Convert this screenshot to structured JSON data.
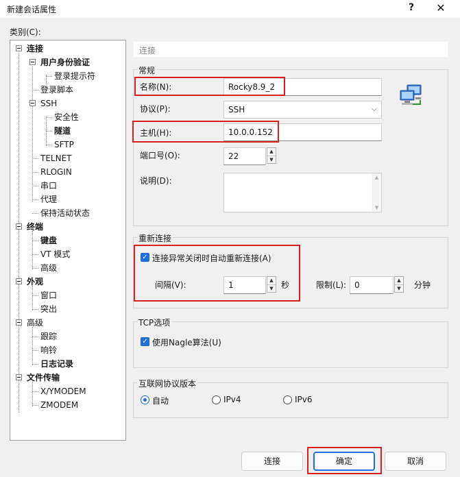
{
  "window": {
    "title": "新建会话属性",
    "help_glyph": "?",
    "close_glyph": "✕"
  },
  "category_label": "类别(C):",
  "tree": [
    {
      "label": "连接",
      "bold": true
    },
    {
      "label": "用户身份验证",
      "bold": true
    },
    {
      "label": "登录提示符",
      "bold": false
    },
    {
      "label": "登录脚本",
      "bold": false
    },
    {
      "label": "SSH",
      "bold": false
    },
    {
      "label": "安全性",
      "bold": false
    },
    {
      "label": "隧道",
      "bold": true
    },
    {
      "label": "SFTP",
      "bold": false
    },
    {
      "label": "TELNET",
      "bold": false
    },
    {
      "label": "RLOGIN",
      "bold": false
    },
    {
      "label": "串口",
      "bold": false
    },
    {
      "label": "代理",
      "bold": false
    },
    {
      "label": "保持活动状态",
      "bold": false
    },
    {
      "label": "终端",
      "bold": true
    },
    {
      "label": "键盘",
      "bold": true
    },
    {
      "label": "VT 模式",
      "bold": false
    },
    {
      "label": "高级",
      "bold": false
    },
    {
      "label": "外观",
      "bold": true
    },
    {
      "label": "窗口",
      "bold": false
    },
    {
      "label": "突出",
      "bold": false
    },
    {
      "label": "高级",
      "bold": false
    },
    {
      "label": "跟踪",
      "bold": false
    },
    {
      "label": "响铃",
      "bold": false
    },
    {
      "label": "日志记录",
      "bold": true
    },
    {
      "label": "文件传输",
      "bold": true
    },
    {
      "label": "X/YMODEM",
      "bold": false
    },
    {
      "label": "ZMODEM",
      "bold": false
    }
  ],
  "breadcrumb": "连接",
  "general": {
    "title": "常规",
    "name_label": "名称(N):",
    "name_value": "Rocky8.9_2",
    "protocol_label": "协议(P):",
    "protocol_value": "SSH",
    "host_label": "主机(H):",
    "host_value": "10.0.0.152",
    "port_label": "端口号(O):",
    "port_value": "22",
    "desc_label": "说明(D):",
    "desc_value": ""
  },
  "reconnect": {
    "title": "重新连接",
    "auto_label": "连接异常关闭时自动重新连接(A)",
    "auto_checked": true,
    "interval_label": "间隔(V):",
    "interval_value": "1",
    "interval_unit": "秒",
    "limit_label": "限制(L):",
    "limit_value": "0",
    "limit_unit": "分钟"
  },
  "tcp": {
    "title": "TCP选项",
    "nagle_label": "使用Nagle算法(U)",
    "nagle_checked": true
  },
  "ipver": {
    "title": "互联网协议版本",
    "options": [
      "自动",
      "IPv4",
      "IPv6"
    ],
    "selected": "自动"
  },
  "buttons": {
    "connect": "连接",
    "ok": "确定",
    "cancel": "取消"
  },
  "colors": {
    "accent": "#1e6fd9",
    "highlight_box": "#d9201c"
  }
}
